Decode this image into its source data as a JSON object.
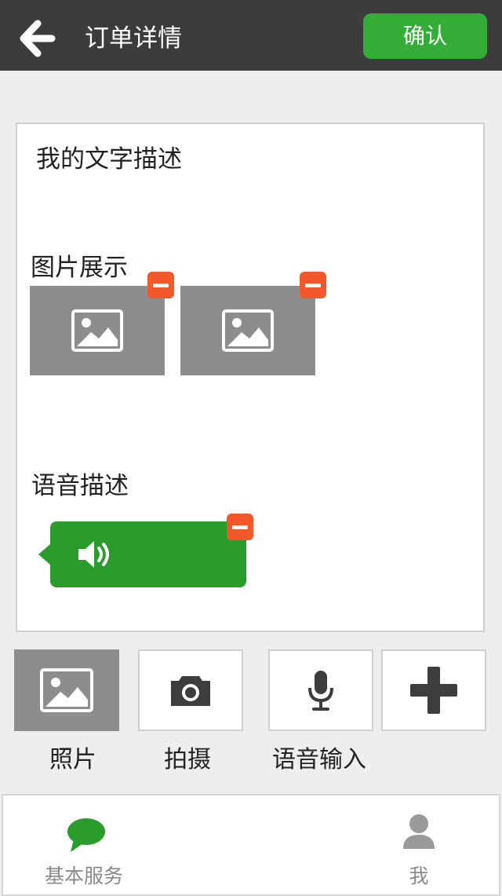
{
  "header": {
    "title": "订单详情",
    "confirm_label": "确认",
    "back_icon": "arrow-left-icon"
  },
  "content": {
    "description": "我的文字描述",
    "images_title": "图片展示",
    "voice_title": "语音描述",
    "image_count": 2
  },
  "toolbar": {
    "photo_label": "照片",
    "camera_label": "拍摄",
    "voice_input_label": "语音输入",
    "icons": [
      "image-icon",
      "camera-icon",
      "microphone-icon",
      "plus-icon"
    ]
  },
  "tabbar": {
    "tabs": [
      {
        "label": "基本服务",
        "icon": "chat-bubble-icon"
      },
      {
        "label": "我",
        "icon": "user-icon"
      }
    ]
  },
  "colors": {
    "header_bg": "#3c3b3d",
    "confirm_green": "#34ad38",
    "voice_green": "#2a9c2c",
    "remove_orange": "#f3582b",
    "thumb_gray": "#8d8d8d",
    "tab_active_green": "#2a9c2c",
    "tab_inactive_gray": "#8a8a8a"
  }
}
